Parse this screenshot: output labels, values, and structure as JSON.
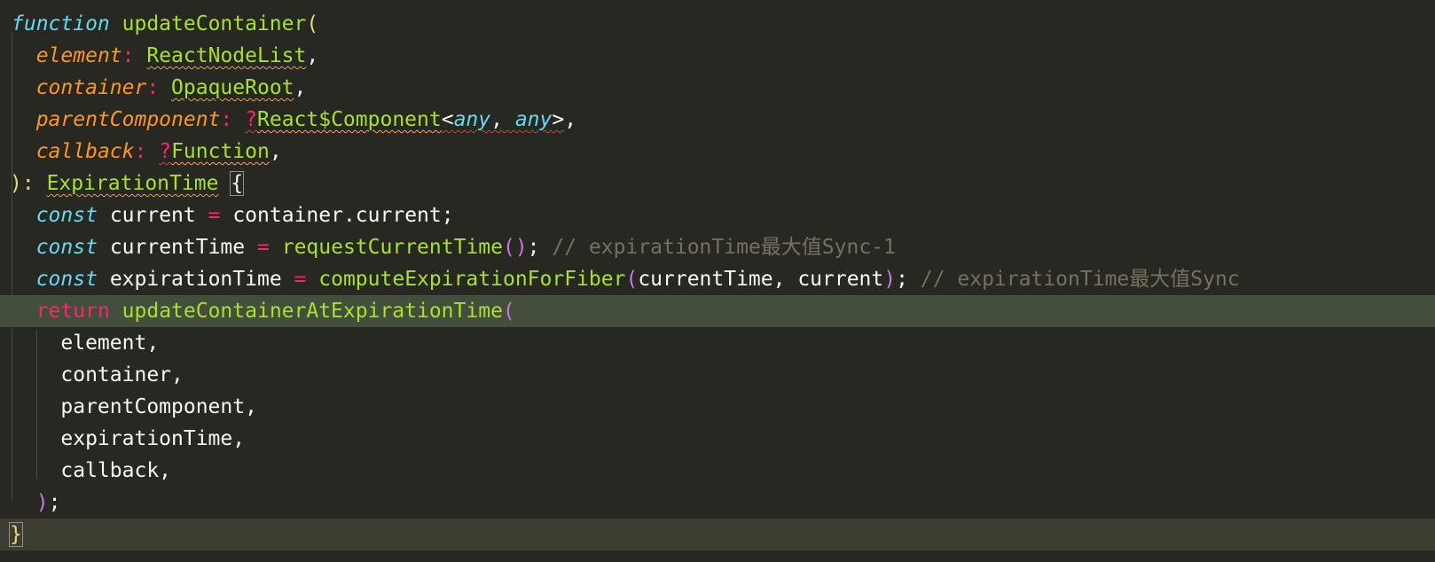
{
  "code": {
    "l1": {
      "kw": "function",
      "name": "updateContainer",
      "paren": "("
    },
    "l2": {
      "param": "element",
      "colon": ":",
      "type": "ReactNodeList",
      "comma": ","
    },
    "l3": {
      "param": "container",
      "colon": ":",
      "type": "OpaqueRoot",
      "comma": ","
    },
    "l4": {
      "param": "parentComponent",
      "colon": ":",
      "maybe": "?",
      "type": "React$Component",
      "lt": "<",
      "any1": "any",
      "sep": ", ",
      "any2": "any",
      "gt": ">",
      "comma": ","
    },
    "l5": {
      "param": "callback",
      "colon": ":",
      "maybe": "?",
      "type": "Function",
      "comma": ","
    },
    "l6": {
      "close": "):",
      "type": "ExpirationTime",
      "brace": "{"
    },
    "l7": {
      "kw": "const",
      "name": "current",
      "eq": "=",
      "rhs": "container.current;"
    },
    "l8": {
      "kw": "const",
      "name": "currentTime",
      "eq": "=",
      "call": "requestCurrentTime",
      "parens": "()",
      "semi": ";",
      "comment": "// expirationTime最大值Sync-1"
    },
    "l9": {
      "kw": "const",
      "name": "expirationTime",
      "eq": "=",
      "call": "computeExpirationForFiber",
      "open": "(",
      "args": "currentTime, current",
      "close": ")",
      "semi": ";",
      "comment": "// expirationTime最大值Sync"
    },
    "l10": {
      "kw": "return",
      "call": "updateContainerAtExpirationTime",
      "open": "("
    },
    "l11": {
      "arg": "element,"
    },
    "l12": {
      "arg": "container,"
    },
    "l13": {
      "arg": "parentComponent,"
    },
    "l14": {
      "arg": "expirationTime,"
    },
    "l15": {
      "arg": "callback,"
    },
    "l16": {
      "close": ")",
      "semi": ";"
    },
    "l17": {
      "brace": "}"
    }
  },
  "colors": {
    "background": "#272822",
    "keyword": "#66d9ef",
    "control": "#f92672",
    "function": "#a6e22e",
    "parameter": "#fd971f",
    "comment": "#75715e",
    "highlight_line": "#434e3c"
  }
}
